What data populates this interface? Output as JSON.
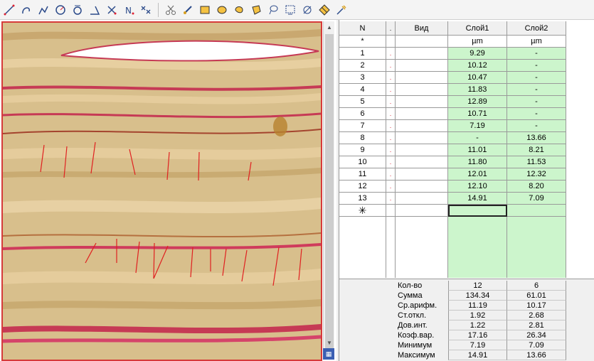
{
  "toolbar": {
    "tools": [
      "line-measure-icon",
      "curve-measure-icon",
      "polyline-icon",
      "angle-icon",
      "angle3-icon",
      "triangle-angle-icon",
      "count-icon",
      "n-marker-icon",
      "multi-count-icon",
      "cut-icon",
      "brush-icon",
      "rectangle-icon",
      "ellipse-icon",
      "freeform-icon",
      "polygon-icon",
      "lasso-icon",
      "rect-select-icon",
      "eraser-icon",
      "clear-icon",
      "settings-icon"
    ]
  },
  "table": {
    "headers": {
      "n": "N",
      "dot": ".",
      "vid": "Вид",
      "s1": "Слой1",
      "s2": "Слой2"
    },
    "unit_row": {
      "n": "*",
      "s1": "µm",
      "s2": "µm"
    },
    "rows": [
      {
        "n": "1",
        "s1": "9.29",
        "s2": "-"
      },
      {
        "n": "2",
        "s1": "10.12",
        "s2": "-"
      },
      {
        "n": "3",
        "s1": "10.47",
        "s2": "-"
      },
      {
        "n": "4",
        "s1": "11.83",
        "s2": "-"
      },
      {
        "n": "5",
        "s1": "12.89",
        "s2": "-"
      },
      {
        "n": "6",
        "s1": "10.71",
        "s2": "-"
      },
      {
        "n": "7",
        "s1": "7.19",
        "s2": "-"
      },
      {
        "n": "8",
        "s1": "-",
        "s2": "13.66"
      },
      {
        "n": "9",
        "s1": "11.01",
        "s2": "8.21"
      },
      {
        "n": "10",
        "s1": "11.80",
        "s2": "11.53"
      },
      {
        "n": "11",
        "s1": "12.01",
        "s2": "12.32"
      },
      {
        "n": "12",
        "s1": "12.10",
        "s2": "8.20"
      },
      {
        "n": "13",
        "s1": "14.91",
        "s2": "7.09"
      }
    ],
    "dot_mark": ".",
    "new_row_marker": "✳"
  },
  "stats": [
    {
      "label": "Кол-во",
      "s1": "12",
      "s2": "6"
    },
    {
      "label": "Сумма",
      "s1": "134.34",
      "s2": "61.01"
    },
    {
      "label": "Ср.арифм.",
      "s1": "11.19",
      "s2": "10.17"
    },
    {
      "label": "Ст.откл.",
      "s1": "1.92",
      "s2": "2.68"
    },
    {
      "label": "Дов.инт.",
      "s1": "1.22",
      "s2": "2.81"
    },
    {
      "label": "Коэф.вар.",
      "s1": "17.16",
      "s2": "26.34"
    },
    {
      "label": "Минимум",
      "s1": "7.19",
      "s2": "7.09"
    },
    {
      "label": "Максимум",
      "s1": "14.91",
      "s2": "13.66"
    }
  ],
  "colors": {
    "accent": "#d63a3a",
    "cell_green": "#ccf5cc",
    "tissue": "#d9c08a"
  }
}
